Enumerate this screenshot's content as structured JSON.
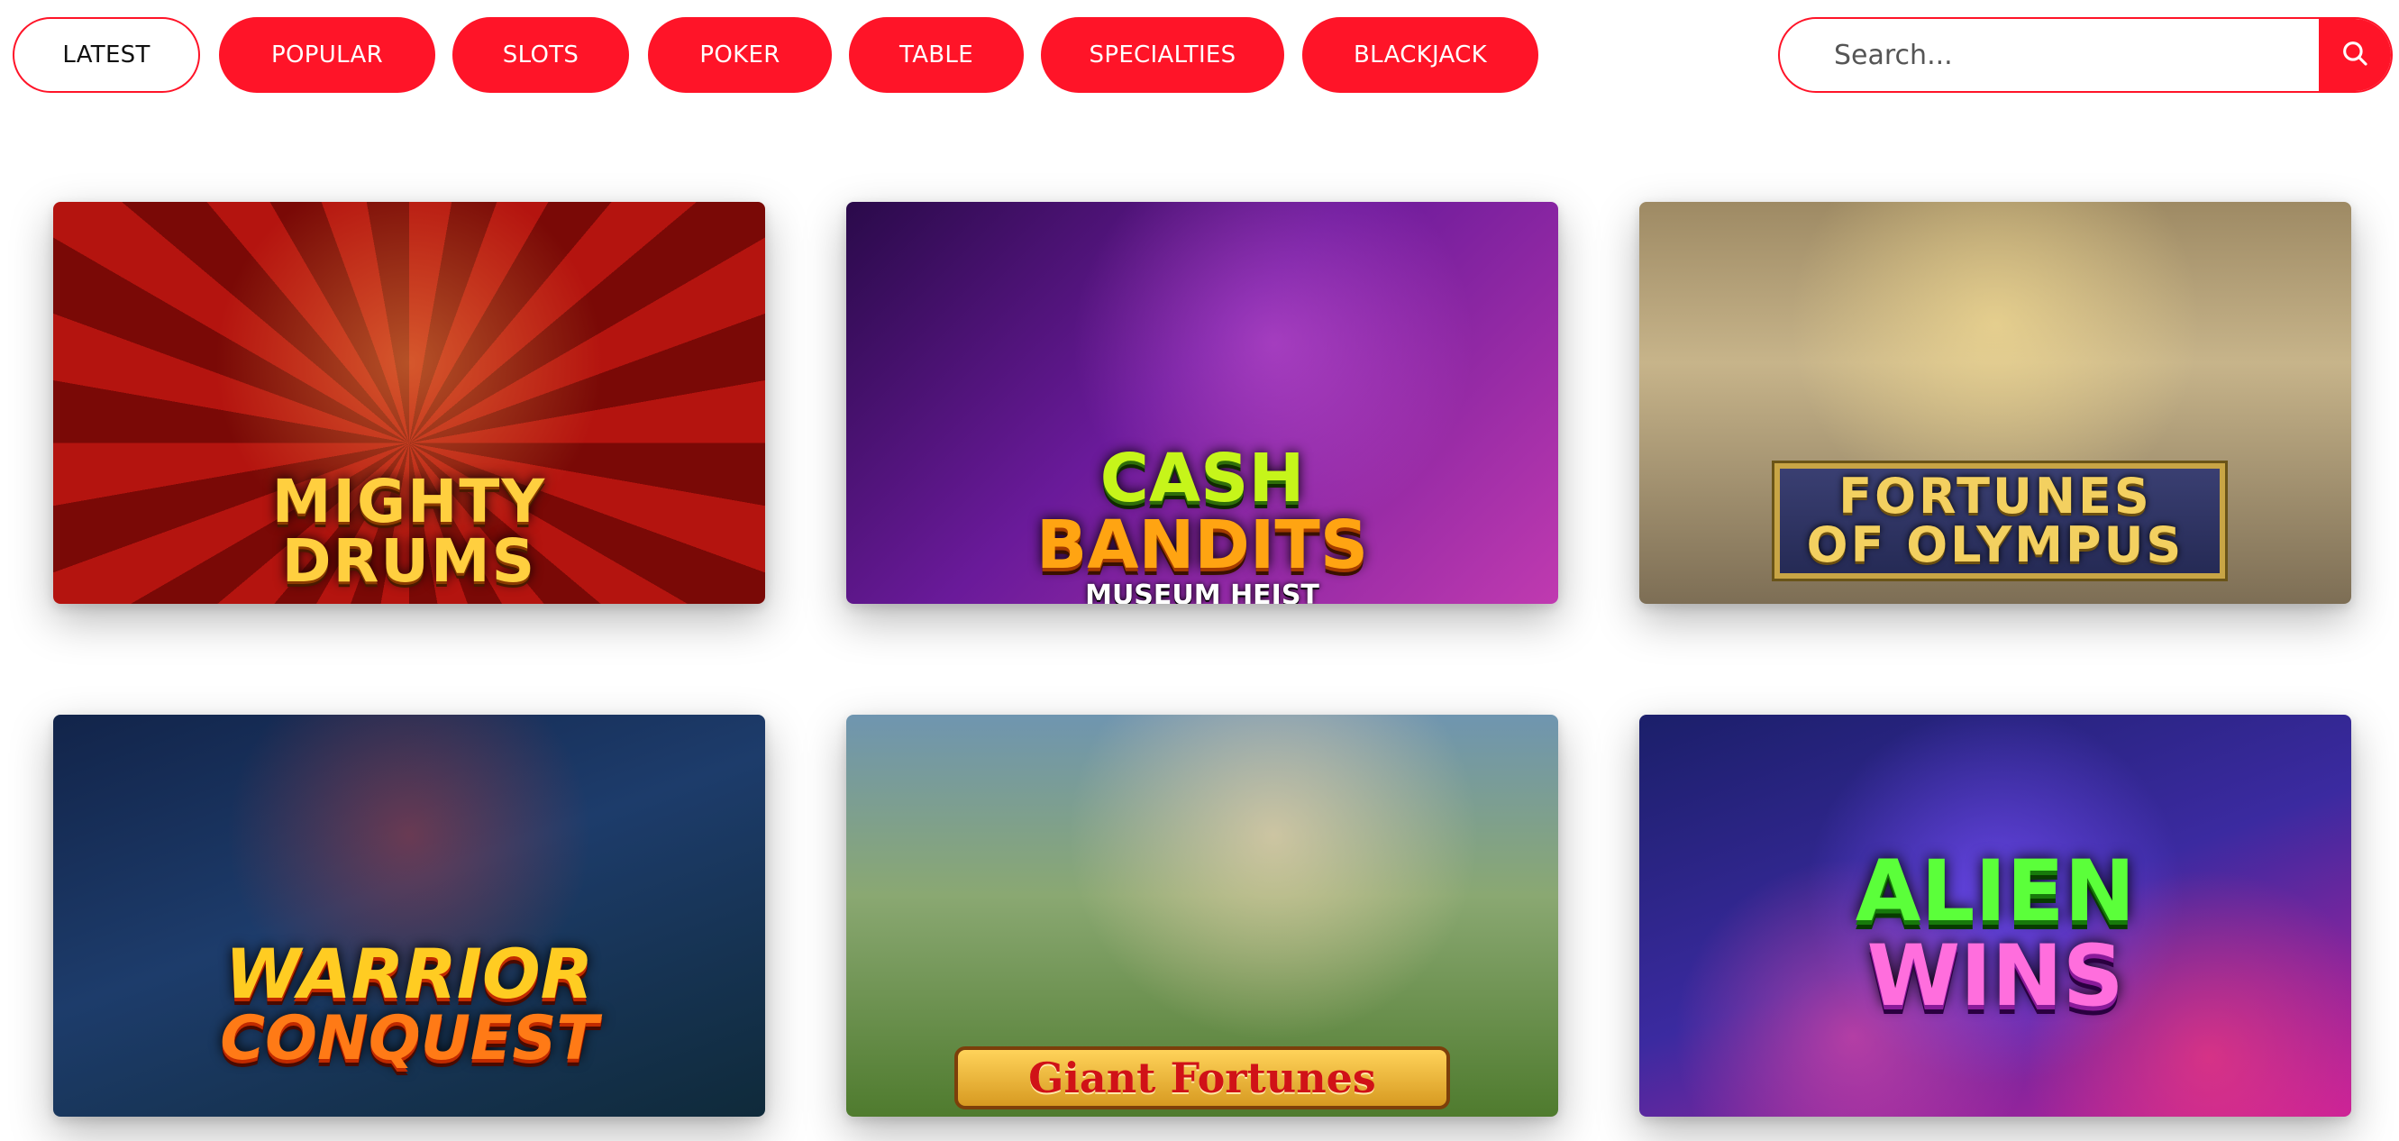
{
  "tabs": [
    {
      "label": "LATEST",
      "active": true
    },
    {
      "label": "POPULAR",
      "active": false
    },
    {
      "label": "SLOTS",
      "active": false
    },
    {
      "label": "POKER",
      "active": false
    },
    {
      "label": "TABLE",
      "active": false
    },
    {
      "label": "SPECIALTIES",
      "active": false
    },
    {
      "label": "BLACKJACK",
      "active": false
    }
  ],
  "search": {
    "placeholder": "Search...",
    "icon": "search-icon"
  },
  "games": [
    {
      "title_line1": "MIGHTY",
      "title_line2": "DRUMS",
      "subtitle": ""
    },
    {
      "title_line1": "CASH",
      "title_line2": "BANDITS",
      "subtitle": "MUSEUM HEIST"
    },
    {
      "title_line1": "FORTUNES",
      "title_line2": "OF OLYMPUS",
      "subtitle": ""
    },
    {
      "title_line1": "WARRIOR",
      "title_line2": "CONQUEST",
      "subtitle": ""
    },
    {
      "title_line1": "Giant Fortunes",
      "title_line2": "",
      "subtitle": ""
    },
    {
      "title_line1": "ALIEN",
      "title_line2": "WINS",
      "subtitle": ""
    }
  ],
  "colors": {
    "accent": "#ff1428",
    "background": "#ffffff"
  }
}
